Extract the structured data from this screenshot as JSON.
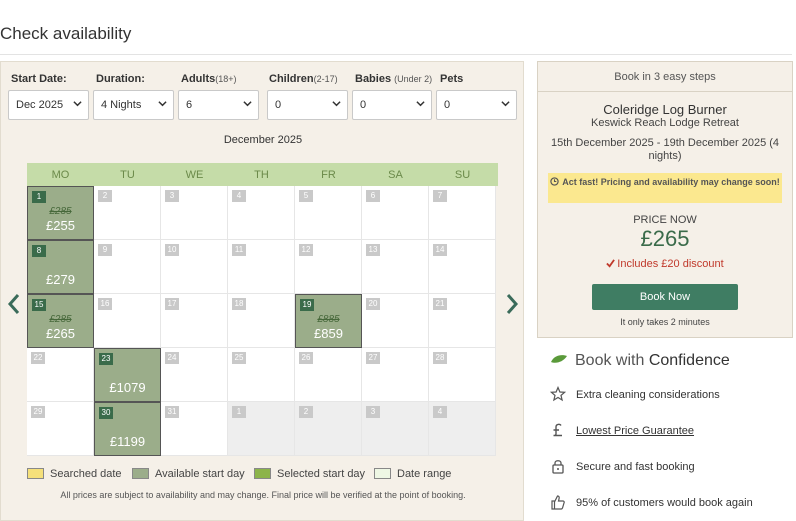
{
  "page": {
    "title": "Check availability"
  },
  "search": {
    "start_date": {
      "label": "Start Date:",
      "value": "Dec 2025"
    },
    "duration": {
      "label": "Duration:",
      "value": "4 Nights"
    },
    "adults": {
      "label": "Adults",
      "sub": "(18+)",
      "value": "6"
    },
    "children": {
      "label": "Children",
      "sub": "(2-17)",
      "value": "0"
    },
    "babies": {
      "label": "Babies",
      "sub": "(Under 2)",
      "value": "0"
    },
    "pets": {
      "label": "Pets",
      "value": "0"
    }
  },
  "calendar": {
    "month": "December 2025",
    "weekdays": [
      "MO",
      "TU",
      "WE",
      "TH",
      "FR",
      "SA",
      "SU"
    ],
    "weeks": [
      [
        {
          "day": "1",
          "avail": true,
          "old": "£285",
          "price": "£255"
        },
        {
          "day": "2"
        },
        {
          "day": "3"
        },
        {
          "day": "4"
        },
        {
          "day": "5"
        },
        {
          "day": "6"
        },
        {
          "day": "7"
        }
      ],
      [
        {
          "day": "8",
          "avail": true,
          "price": "£279"
        },
        {
          "day": "9"
        },
        {
          "day": "10"
        },
        {
          "day": "11"
        },
        {
          "day": "12"
        },
        {
          "day": "13"
        },
        {
          "day": "14"
        }
      ],
      [
        {
          "day": "15",
          "avail": true,
          "old": "£285",
          "price": "£265"
        },
        {
          "day": "16"
        },
        {
          "day": "17"
        },
        {
          "day": "18"
        },
        {
          "day": "19",
          "avail": true,
          "old": "£885",
          "price": "£859"
        },
        {
          "day": "20"
        },
        {
          "day": "21"
        }
      ],
      [
        {
          "day": "22"
        },
        {
          "day": "23",
          "avail": true,
          "price": "£1079"
        },
        {
          "day": "24"
        },
        {
          "day": "25"
        },
        {
          "day": "26"
        },
        {
          "day": "27"
        },
        {
          "day": "28"
        }
      ],
      [
        {
          "day": "29"
        },
        {
          "day": "30",
          "avail": true,
          "price": "£1199"
        },
        {
          "day": "31"
        },
        {
          "day": "1",
          "outside": true
        },
        {
          "day": "2",
          "outside": true
        },
        {
          "day": "3",
          "outside": true
        },
        {
          "day": "4",
          "outside": true
        }
      ]
    ],
    "legend": [
      {
        "label": "Searched date",
        "color": "#f5e07a"
      },
      {
        "label": "Available start day",
        "color": "#9bad8a"
      },
      {
        "label": "Selected start day",
        "color": "#8cb44a"
      },
      {
        "label": "Date range",
        "color": "#eef7e4"
      }
    ],
    "disclaimer": "All prices are subject to availability and may change. Final price will be verified at the point of booking."
  },
  "booking": {
    "header": "Book in 3 easy steps",
    "property": "Coleridge Log Burner",
    "location": "Keswick Reach Lodge Retreat",
    "dates": "15th December 2025 - 19th December 2025 (4 nights)",
    "alert": "Act fast! Pricing and availability may change soon!",
    "price_label": "PRICE NOW",
    "price": "£265",
    "discount": "Includes £20 discount",
    "button": "Book Now",
    "note": "It only takes 2 minutes"
  },
  "confidence": {
    "heading_pre": "Book with",
    "heading_main": "Confidence",
    "items": [
      {
        "icon": "star-icon",
        "label": "Extra cleaning considerations"
      },
      {
        "icon": "pound-icon",
        "label": "Lowest Price Guarantee"
      },
      {
        "icon": "lock-icon",
        "label": "Secure and fast booking"
      },
      {
        "icon": "thumbs-up-icon",
        "label": "95% of customers would book again"
      }
    ]
  },
  "colors": {
    "accent": "#3f7d63",
    "available": "#9bad8a",
    "weekday_bar": "#c5dca8",
    "alert": "#fbe88f"
  }
}
